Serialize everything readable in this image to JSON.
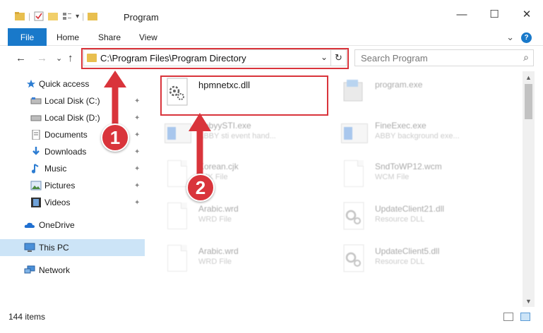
{
  "window": {
    "title": "Program",
    "controls": {
      "minimize": "—",
      "maximize": "☐",
      "close": "✕"
    }
  },
  "ribbon": {
    "file": "File",
    "tabs": [
      "Home",
      "Share",
      "View"
    ],
    "expand": "⌄",
    "help": "?"
  },
  "nav": {
    "back": "←",
    "forward": "→",
    "recent": "⌄",
    "up": "↑",
    "address": "C:\\Program Files\\Program Directory",
    "address_dropdown": "⌄",
    "refresh": "↻",
    "search_placeholder": "Search Program",
    "search_icon": "⌕"
  },
  "sidebar": {
    "items": [
      {
        "label": "Quick access",
        "icon": "star-icon",
        "pinned": false
      },
      {
        "label": "Local Disk (C:)",
        "icon": "drive-icon",
        "pinned": true
      },
      {
        "label": "Local Disk (D:)",
        "icon": "drive-icon",
        "pinned": true
      },
      {
        "label": "Documents",
        "icon": "documents-icon",
        "pinned": true
      },
      {
        "label": "Downloads",
        "icon": "download-icon",
        "pinned": true
      },
      {
        "label": "Music",
        "icon": "music-icon",
        "pinned": true
      },
      {
        "label": "Pictures",
        "icon": "pictures-icon",
        "pinned": true
      },
      {
        "label": "Videos",
        "icon": "videos-icon",
        "pinned": true
      },
      {
        "label": "OneDrive",
        "icon": "cloud-icon",
        "pinned": false
      },
      {
        "label": "This PC",
        "icon": "computer-icon",
        "pinned": false,
        "selected": true
      },
      {
        "label": "Network",
        "icon": "network-icon",
        "pinned": false
      }
    ],
    "pin_glyph": "📌"
  },
  "files": [
    {
      "name": "hpmnetxc.dll",
      "desc": "",
      "icon": "dll-gear-icon",
      "highlighted": true
    },
    {
      "name": "program.exe",
      "desc": "",
      "icon": "installer-icon"
    },
    {
      "name": "AbbyySTI.exe",
      "desc": "ABBY sti event hand...",
      "icon": "exe-icon"
    },
    {
      "name": "FineExec.exe",
      "desc": "ABBY background exe...",
      "icon": "exe-icon"
    },
    {
      "name": "Korean.cjk",
      "desc": "CJK File",
      "icon": "file-icon"
    },
    {
      "name": "SndToWP12.wcm",
      "desc": "WCM File",
      "icon": "file-icon"
    },
    {
      "name": "Arabic.wrd",
      "desc": "WRD File",
      "icon": "file-icon"
    },
    {
      "name": "UpdateClient21.dll",
      "desc": "Resource DLL",
      "icon": "dll-gear-icon"
    },
    {
      "name": "Arabic.wrd",
      "desc": "WRD File",
      "icon": "file-icon"
    },
    {
      "name": "UpdateClient5.dll",
      "desc": "Resource DLL",
      "icon": "dll-gear-icon"
    }
  ],
  "status": {
    "count": "144 items"
  },
  "callouts": [
    "1",
    "2"
  ],
  "colors": {
    "accent": "#1979ca",
    "highlight": "#d9343b",
    "selected": "#cce4f7"
  }
}
